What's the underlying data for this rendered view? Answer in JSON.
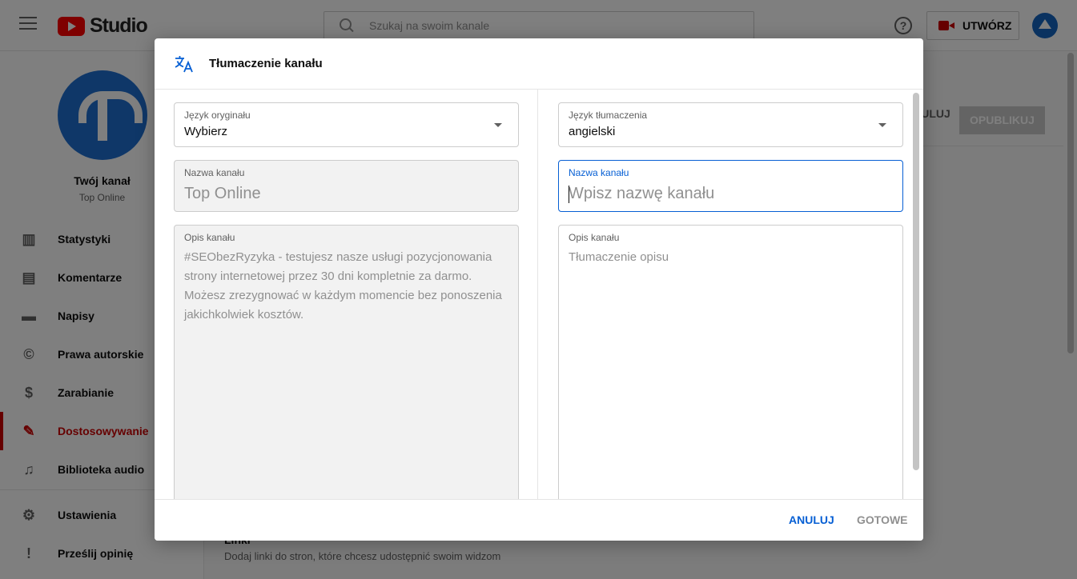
{
  "app": {
    "logo_text": "Studio"
  },
  "search": {
    "placeholder": "Szukaj na swoim kanale"
  },
  "header": {
    "help_icon": "?",
    "create_label": "UTWÓRZ"
  },
  "sidebar": {
    "channel_title": "Twój kanał",
    "channel_name": "Top Online",
    "items": [
      {
        "label": "Statystyki",
        "icon": "bar-chart-icon",
        "glyph": "▥"
      },
      {
        "label": "Komentarze",
        "icon": "comment-icon",
        "glyph": "▤"
      },
      {
        "label": "Napisy",
        "icon": "subtitles-icon",
        "glyph": "▬"
      },
      {
        "label": "Prawa autorskie",
        "icon": "copyright-icon",
        "glyph": "©"
      },
      {
        "label": "Zarabianie",
        "icon": "dollar-icon",
        "glyph": "$"
      },
      {
        "label": "Dostosowywanie",
        "icon": "magic-wand-icon",
        "glyph": "✎"
      },
      {
        "label": "Biblioteka audio",
        "icon": "audio-library-icon",
        "glyph": "♫"
      },
      {
        "label": "Ustawienia",
        "icon": "gear-icon",
        "glyph": "⚙"
      },
      {
        "label": "Prześlij opinię",
        "icon": "feedback-icon",
        "glyph": "!"
      }
    ],
    "active_color": "#cc0000"
  },
  "main": {
    "cancel_label": "ANULUJ",
    "publish_label": "OPUBLIKUJ",
    "links_title": "Linki",
    "links_subtitle": "Dodaj linki do stron, które chcesz udostępnić swoim widzom"
  },
  "dialog": {
    "title": "Tłumaczenie kanału",
    "left": {
      "language_label": "Język oryginału",
      "language_value": "Wybierz",
      "name_label": "Nazwa kanału",
      "name_value": "Top Online",
      "description_label": "Opis kanału",
      "description_value": "#SEObezRyzyka - testujesz nasze usługi pozycjonowania strony internetowej przez 30 dni kompletnie za darmo. Możesz zrezygnować w każdym momencie bez ponoszenia jakichkolwiek kosztów."
    },
    "right": {
      "language_label": "Język tłumaczenia",
      "language_value": "angielski",
      "name_label": "Nazwa kanału",
      "name_placeholder": "Wpisz nazwę kanału",
      "description_label": "Opis kanału",
      "description_placeholder": "Tłumaczenie opisu"
    },
    "footer": {
      "cancel_label": "ANULUJ",
      "done_label": "GOTOWE"
    },
    "accent_color": "#065fd4"
  }
}
